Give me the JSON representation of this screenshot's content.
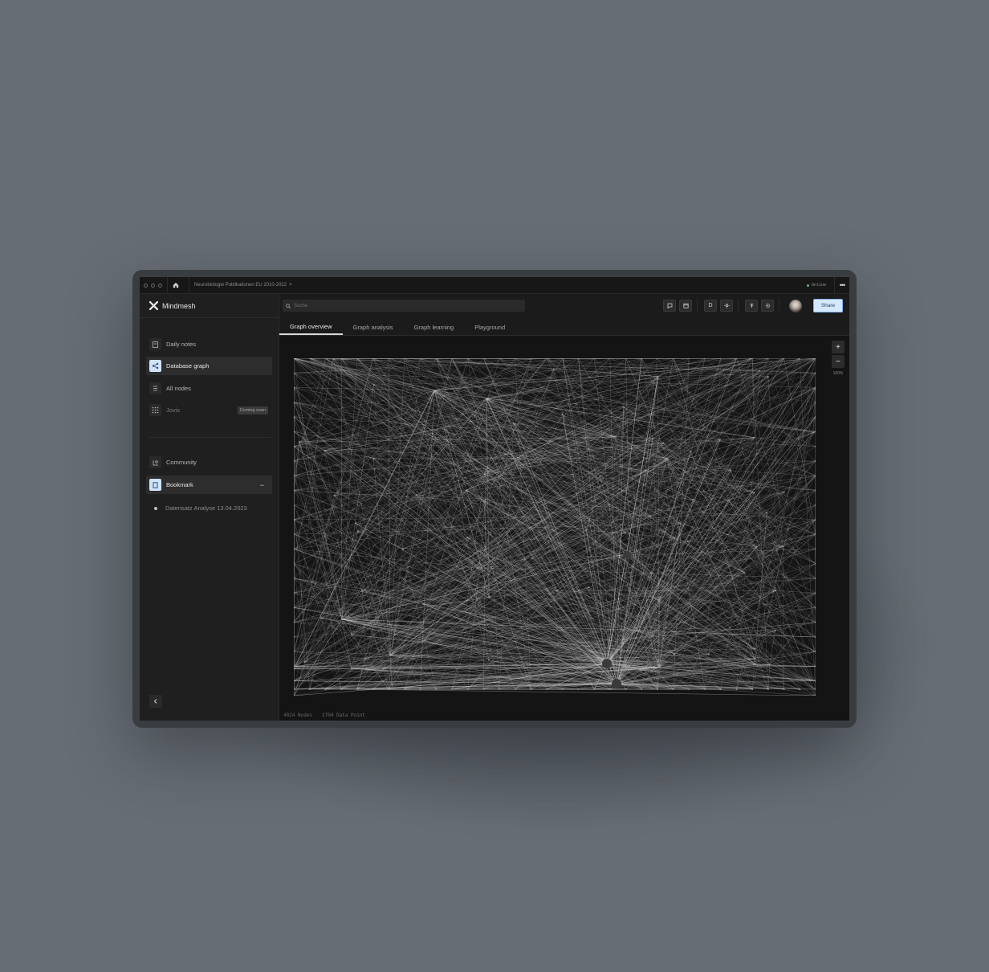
{
  "window": {
    "doc_title": "Neurobiologie Publikationen EU 2010-2022",
    "status_label": "Online"
  },
  "brand": {
    "name": "Mindmesh"
  },
  "search": {
    "placeholder": "Suche"
  },
  "toolbar": {
    "share_label": "Share",
    "d_label": "D"
  },
  "sidebar": {
    "items": [
      {
        "label": "Daily notes",
        "icon": "calendar-icon"
      },
      {
        "label": "Database graph",
        "icon": "graph-icon"
      },
      {
        "label": "All nodes",
        "icon": "list-icon"
      },
      {
        "label": "Jovis",
        "icon": "grid-icon",
        "badge": "Coming soon"
      }
    ],
    "items2": [
      {
        "label": "Community",
        "icon": "community-icon"
      },
      {
        "label": "Bookmark",
        "icon": "bookmark-icon",
        "toggle": "−"
      }
    ],
    "bookmark_entries": [
      {
        "label": "Datensatz Analyse 13.04.2023"
      }
    ]
  },
  "tabs": [
    "Graph overview",
    "Graph analysis",
    "Graph learning",
    "Playground"
  ],
  "zoom": {
    "plus": "+",
    "minus": "−",
    "level": "100%"
  },
  "stats": {
    "nodes": "4024 Nodes",
    "points": "1704 Data Point"
  },
  "colors": {
    "accent": "#d6e8fd",
    "accent_border": "#7fb2ef",
    "online": "#5fb878"
  }
}
